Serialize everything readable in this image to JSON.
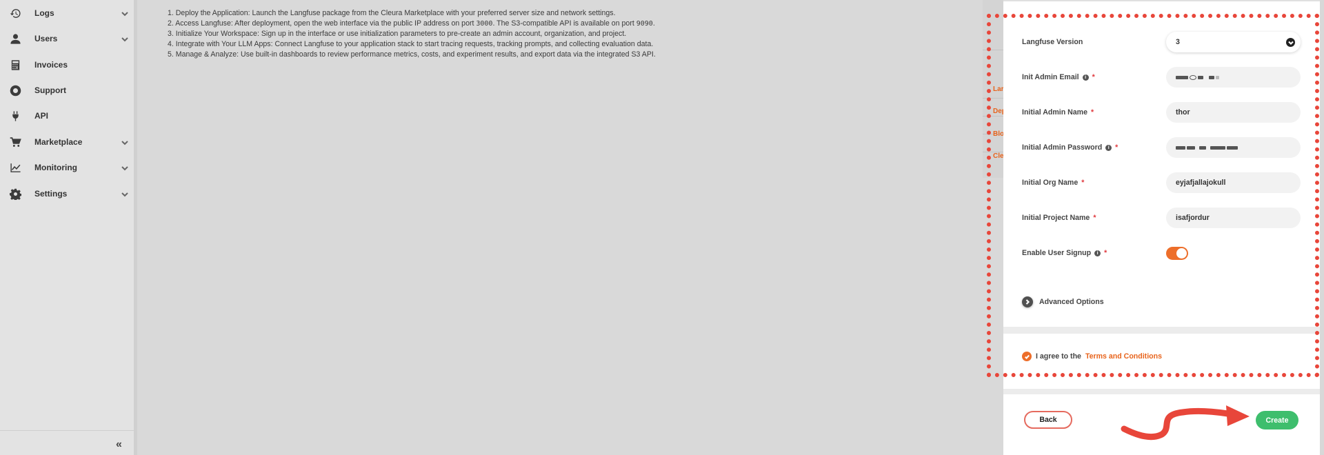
{
  "sidebar": {
    "items": [
      {
        "label": "Logs",
        "icon": "history-icon",
        "chevron": true
      },
      {
        "label": "Users",
        "icon": "user-icon",
        "chevron": true
      },
      {
        "label": "Invoices",
        "icon": "calculator-icon",
        "chevron": false
      },
      {
        "label": "Support",
        "icon": "lifebuoy-icon",
        "chevron": false
      },
      {
        "label": "API",
        "icon": "plug-icon",
        "chevron": false
      },
      {
        "label": "Marketplace",
        "icon": "cart-icon",
        "chevron": true
      },
      {
        "label": "Monitoring",
        "icon": "chart-line-icon",
        "chevron": true
      },
      {
        "label": "Settings",
        "icon": "gear-icon",
        "chevron": true
      }
    ],
    "collapse_label": "«"
  },
  "steps": {
    "s1": "1. Deploy the Application: Launch the Langfuse package from the Cleura Marketplace with your preferred server size and network settings.",
    "s2_a": "2. Access Langfuse: After deployment, open the web interface via the public IP address on port ",
    "s2_port1": "3000",
    "s2_b": ". The S3-compatible API is available on port ",
    "s2_port2": "9090",
    "s2_c": ".",
    "s3": "3. Initialize Your Workspace: Sign up in the interface or use initialization parameters to pre-create an admin account, organization, and project.",
    "s4": "4. Integrate with Your LLM Apps: Connect Langfuse to your application stack to start tracing requests, tracking prompts, and collecting evaluation data.",
    "s5": "5. Manage & Analyze: Use built-in dashboards to review performance metrics, costs, and experiment results, and export data via the integrated S3 API."
  },
  "bg_links": [
    "Lar",
    "Dep",
    "Blo",
    "Cle"
  ],
  "form": {
    "version_label": "Langfuse Version",
    "version_value": "3",
    "email_label": "Init Admin Email",
    "name_label": "Initial Admin Name",
    "name_value": "thor",
    "password_label": "Initial Admin Password",
    "org_label": "Initial Org Name",
    "org_value": "eyjafjallajokull",
    "project_label": "Initial Project Name",
    "project_value": "isafjordur",
    "signup_label": "Enable User Signup",
    "signup_enabled": true,
    "required_mark": "*",
    "info_mark": "i",
    "advanced_label": "Advanced Options"
  },
  "agree": {
    "text": "I agree to the ",
    "link": "Terms and Conditions",
    "checked": true
  },
  "footer": {
    "back_label": "Back",
    "create_label": "Create"
  },
  "colors": {
    "accent": "#ed6e2a",
    "create": "#3ebe6d",
    "annotation": "#e8463a"
  }
}
